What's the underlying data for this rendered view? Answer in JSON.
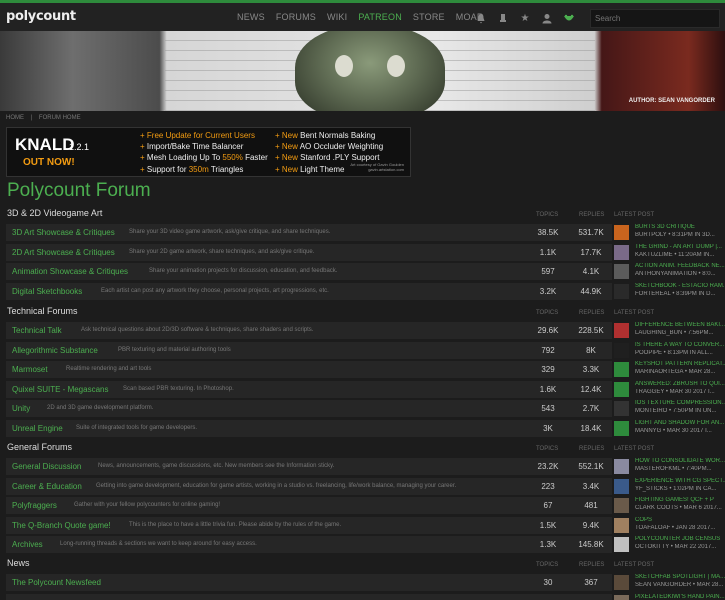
{
  "header": {
    "logo": "polycount",
    "nav": [
      "NEWS",
      "FORUMS",
      "WIKI",
      "PATREON",
      "STORE",
      "MOAR"
    ],
    "active_nav": "PATREON",
    "search_placeholder": "Search"
  },
  "banner": {
    "credit": "AUTHOR: SEAN VANGORDER"
  },
  "breadcrumb": [
    "HOME",
    "|",
    "FORUM HOME"
  ],
  "ad": {
    "brand": "KNALD",
    "version": "1.2.1",
    "cta": "OUT NOW!",
    "features_left": [
      {
        "pre": "",
        "hl": "Free Update for Current Users",
        "post": ""
      },
      {
        "pre": "Import/Bake Time Balancer",
        "hl": "",
        "post": ""
      },
      {
        "pre": "Mesh Loading Up To ",
        "hl": "550%",
        "post": " Faster"
      },
      {
        "pre": "Support for ",
        "hl": "350m",
        "post": " Triangles"
      }
    ],
    "features_right": [
      {
        "pre": "",
        "hl": "New",
        "post": " Bent Normals Baking"
      },
      {
        "pre": "",
        "hl": "New",
        "post": " AO Occluder Weighting"
      },
      {
        "pre": "",
        "hl": "New",
        "post": " Stanford .PLY Support"
      },
      {
        "pre": "",
        "hl": "New",
        "post": " Light Theme"
      }
    ],
    "courtesy_1": "Art courtesy of Gavin Goulden",
    "courtesy_2": "gavin.artstation.com"
  },
  "forum": {
    "title": "Polycount Forum",
    "col_topics": "TOPICS",
    "col_replies": "REPLIES",
    "col_latest": "LATEST POST",
    "sections": [
      {
        "title": "3D & 2D Videogame Art",
        "rows": [
          {
            "name": "3D Art Showcase & Critiques",
            "desc": "Share your 3D video game artwork, ask/give critique, and share techniques.",
            "topics": "38.5K",
            "replies": "531.7K",
            "latest_title": "BURTS 3D CRITIQUE",
            "latest_meta": "BURTPOLY  • 8:31PM  IN 3D...",
            "avatar_color": "#c8641e"
          },
          {
            "name": "2D Art Showcase & Critiques",
            "desc": "Share your 2D game artwork, share techniques, and ask/give critique.",
            "topics": "1.1K",
            "replies": "17.7K",
            "latest_title": "THE GRIND - AN ART DUMP |...",
            "latest_meta": "KAKTUZLIME  • 11:20AM  IN...",
            "avatar_color": "#7a6a88"
          },
          {
            "name": "Animation Showcase & Critiques",
            "desc": "Share your animation projects for discussion, education, and feedback.",
            "topics": "597",
            "replies": "4.1K",
            "latest_title": "ACTION ANIM. FEEDBACK NE...",
            "latest_meta": "ANTHONYANIMATION  • 8:0...",
            "avatar_color": "#5b5b5b"
          },
          {
            "name": "Digital Sketchbooks",
            "desc": "Each artist can post any artwork they choose, personal projects, art progressions, etc.",
            "topics": "3.2K",
            "replies": "44.9K",
            "latest_title": "SKETCHBOOK - ESTACIO RAM...",
            "latest_meta": "FORTEREAL  • 8:39PM  IN D...",
            "avatar_color": "#2a2a2a"
          }
        ]
      },
      {
        "title": "Technical Forums",
        "rows": [
          {
            "name": "Technical Talk",
            "desc": "Ask technical questions about 2D/3D software & techniques, share shaders and scripts.",
            "topics": "29.6K",
            "replies": "228.5K",
            "latest_title": "DIFFERENCE BETWEEN BAKI...",
            "latest_meta": "LAUGHING_BUN  • 7:56PM...",
            "avatar_color": "#b03030"
          },
          {
            "name": "Allegorithmic Substance",
            "desc": "PBR texturing and material authoring tools",
            "topics": "792",
            "replies": "8K",
            "latest_title": "IS THERE A WAY TO CONVER...",
            "latest_meta": "POOPIPE  • 8:13PM  IN ALL...",
            "avatar_color": "#1f1f1f"
          },
          {
            "name": "Marmoset",
            "desc": "Realtime rendering and art tools",
            "topics": "329",
            "replies": "3.3K",
            "latest_title": "KEYSHOT PATTERN REPLICAT...",
            "latest_meta": "MARINAORTEGA  • MAR 28...",
            "avatar_color": "#2e8b3c"
          },
          {
            "name": "Quixel SUITE - Megascans",
            "desc": "Scan based PBR texturing. In Photoshop.",
            "topics": "1.6K",
            "replies": "12.4K",
            "latest_title": "ANSWERED: ZBRUSH TO QUI...",
            "latest_meta": "TRAGGEY  • MAR 30 2017  I...",
            "avatar_color": "#2e8b3c"
          },
          {
            "name": "Unity",
            "desc": "2D and 3D game development platform.",
            "topics": "543",
            "replies": "2.7K",
            "latest_title": "IOS TEXTURE COMPRESSION...",
            "latest_meta": "MONTEIRO  • 7:50PM  IN UN...",
            "avatar_color": "#333333"
          },
          {
            "name": "Unreal Engine",
            "desc": "Suite of integrated tools for game developers.",
            "topics": "3K",
            "replies": "18.4K",
            "latest_title": "LIGHT AND SHADOW FOR AN...",
            "latest_meta": "MANNYG  • MAR 30 2017  I...",
            "avatar_color": "#2e8b3c"
          }
        ]
      },
      {
        "title": "General Forums",
        "rows": [
          {
            "name": "General Discussion",
            "desc": "News, announcements, game discussions, etc. New members see the Information sticky.",
            "topics": "23.2K",
            "replies": "552.1K",
            "latest_title": "HOW TO CONSOLIDATE WOR...",
            "latest_meta": "MASTEROFKML  • 7:40PM...",
            "avatar_color": "#8a8aa0"
          },
          {
            "name": "Career & Education",
            "desc": "Getting into game development, education for game artists, working in a studio vs. freelancing, life/work balance, managing your career.",
            "topics": "223",
            "replies": "3.4K",
            "latest_title": "EXPERIENCE WITH CG SPECT...",
            "latest_meta": "YF_STICKS  • 1:02PM  IN CA...",
            "avatar_color": "#3a5a8a"
          },
          {
            "name": "Polyfraggers",
            "desc": "Gather with your fellow polycounters for online gaming!",
            "topics": "67",
            "replies": "481",
            "latest_title": "FIGHTING GAMES! QCF + P",
            "latest_meta": "CLARK COOTS  • MAR 6 2017...",
            "avatar_color": "#6a5a4a"
          },
          {
            "name": "The Q-Branch Quote game!",
            "desc": "This is the place to have a little trivia fun. Please abide by the rules of the game.",
            "topics": "1.5K",
            "replies": "9.4K",
            "latest_title": "COPS",
            "latest_meta": "TOAFALOAF  • JAN 28 2017...",
            "avatar_color": "#a08060"
          },
          {
            "name": "Archives",
            "desc": "Long-running threads & sections we want to keep around for easy access.",
            "topics": "1.3K",
            "replies": "145.8K",
            "latest_title": "POLYCOUNTER JOB CENSUS",
            "latest_meta": "OCTOKITTY  • MAR 22 2017...",
            "avatar_color": "#c0c0c0"
          }
        ]
      },
      {
        "title": "News",
        "rows": [
          {
            "name": "The Polycount Newsfeed",
            "desc": "",
            "topics": "30",
            "replies": "367",
            "latest_title": "SKETCHFAB SPOTLIGHT | MA...",
            "latest_meta": "SEAN VANGORDER  • MAR 28...",
            "avatar_color": "#5a4a3a"
          }
        ]
      }
    ]
  },
  "partial_row": {
    "latest_title": "PIXELATEDKIWI'S HAND PAIN..."
  }
}
